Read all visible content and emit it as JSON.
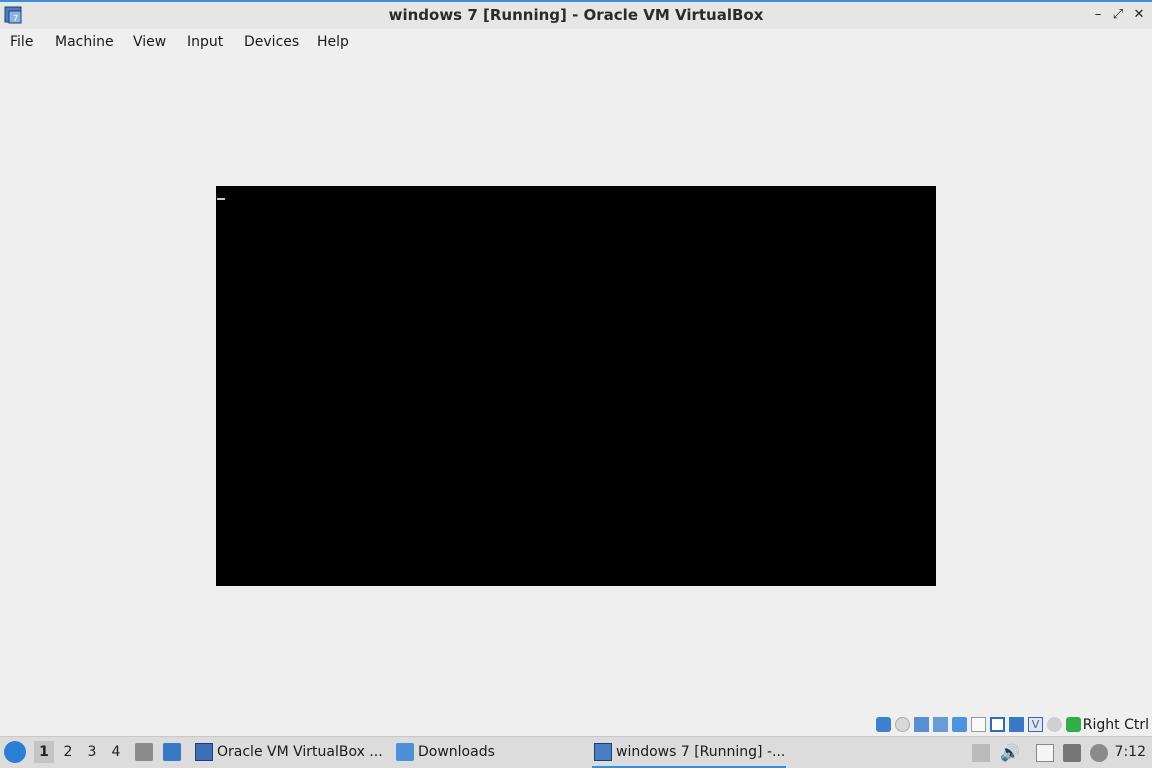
{
  "window": {
    "title": "windows 7 [Running] - Oracle VM VirtualBox",
    "icon": "virtualbox-icon",
    "controls": [
      "minimize-icon",
      "restore-icon",
      "close-icon"
    ]
  },
  "menubar": {
    "items": [
      "File",
      "Machine",
      "View",
      "Input",
      "Devices",
      "Help"
    ]
  },
  "vm": {
    "screen_color": "#000000"
  },
  "statusbar": {
    "icons": [
      "hard-disk-icon",
      "optical-drive-icon",
      "audio-icon",
      "network-icon",
      "usb-icon",
      "shared-folders-icon",
      "display-icon",
      "recording-icon",
      "vt-x-icon",
      "mouse-integration-icon",
      "keyboard-capture-icon"
    ],
    "host_key": "Right Ctrl"
  },
  "taskbar": {
    "workspaces": [
      "1",
      "2",
      "3",
      "4"
    ],
    "active_workspace": "1",
    "tasks": [
      {
        "label": "Oracle VM VirtualBox ...",
        "icon": "virtualbox-manager-icon"
      },
      {
        "label": "Downloads",
        "icon": "folder-icon"
      },
      {
        "label": "windows 7 [Running] -...",
        "icon": "virtualbox-vm-icon"
      }
    ],
    "clock": "7:12"
  },
  "colors": {
    "accent": "#3b8ed8",
    "background": "#efefef",
    "taskbar": "#dcdcdc"
  }
}
